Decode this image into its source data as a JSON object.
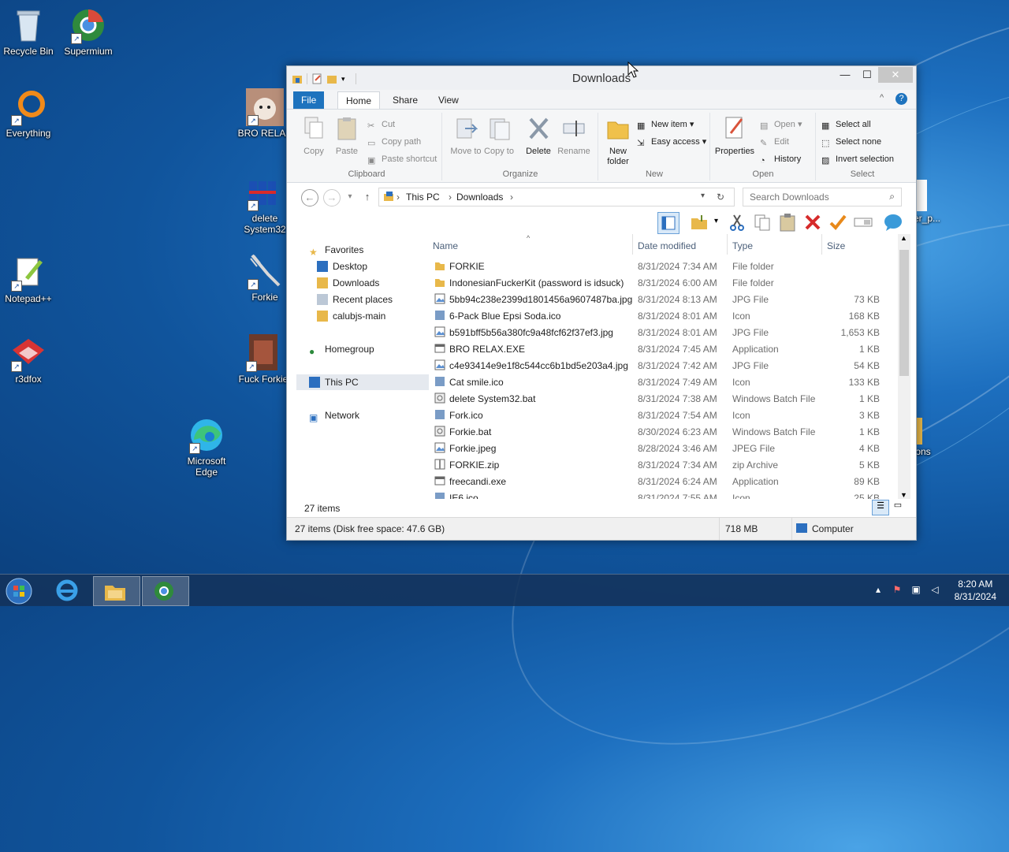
{
  "desktop": {
    "icons": [
      {
        "label": "Recycle Bin"
      },
      {
        "label": "Supermium"
      },
      {
        "label": "Everything"
      },
      {
        "label": "BRO RELAX"
      },
      {
        "label": "delete System32"
      },
      {
        "label": "Notepad++"
      },
      {
        "label": "Forkie"
      },
      {
        "label": "r3dfox"
      },
      {
        "label": "Fuck Forkie"
      },
      {
        "label": "Microsoft Edge"
      },
      {
        "label": "er_p..."
      },
      {
        "label": "ons"
      }
    ]
  },
  "window": {
    "title": "Downloads",
    "tabs": {
      "file": "File",
      "home": "Home",
      "share": "Share",
      "view": "View"
    },
    "ribbon": {
      "clipboard": {
        "label": "Clipboard",
        "copy": "Copy",
        "paste": "Paste",
        "cut": "Cut",
        "copy_path": "Copy path",
        "paste_shortcut": "Paste shortcut"
      },
      "organize": {
        "label": "Organize",
        "move_to": "Move to",
        "copy_to": "Copy to",
        "delete": "Delete",
        "rename": "Rename"
      },
      "new": {
        "label": "New",
        "new_folder": "New folder",
        "new_item": "New item",
        "easy_access": "Easy access"
      },
      "open": {
        "label": "Open",
        "properties": "Properties",
        "open": "Open",
        "edit": "Edit",
        "history": "History"
      },
      "select": {
        "label": "Select",
        "select_all": "Select all",
        "select_none": "Select none",
        "invert": "Invert selection"
      }
    },
    "address": {
      "crumb1": "This PC",
      "crumb2": "Downloads",
      "search_placeholder": "Search Downloads"
    },
    "nav": {
      "favorites": "Favorites",
      "desktop": "Desktop",
      "downloads": "Downloads",
      "recent": "Recent places",
      "calubjs": "calubjs-main",
      "homegroup": "Homegroup",
      "thispc": "This PC",
      "network": "Network"
    },
    "columns": {
      "name": "Name",
      "date": "Date modified",
      "type": "Type",
      "size": "Size"
    },
    "files": [
      {
        "name": "FORKIE",
        "date": "8/31/2024 7:34 AM",
        "type": "File folder",
        "size": ""
      },
      {
        "name": "IndonesianFuckerKit (password is idsuck)",
        "date": "8/31/2024 6:00 AM",
        "type": "File folder",
        "size": ""
      },
      {
        "name": "5bb94c238e2399d1801456a9607487ba.jpg",
        "date": "8/31/2024 8:13 AM",
        "type": "JPG File",
        "size": "73 KB"
      },
      {
        "name": "6-Pack Blue Epsi Soda.ico",
        "date": "8/31/2024 8:01 AM",
        "type": "Icon",
        "size": "168 KB"
      },
      {
        "name": "b591bff5b56a380fc9a48fcf62f37ef3.jpg",
        "date": "8/31/2024 8:01 AM",
        "type": "JPG File",
        "size": "1,653 KB"
      },
      {
        "name": "BRO RELAX.EXE",
        "date": "8/31/2024 7:45 AM",
        "type": "Application",
        "size": "1 KB"
      },
      {
        "name": "c4e93414e9e1f8c544cc6b1bd5e203a4.jpg",
        "date": "8/31/2024 7:42 AM",
        "type": "JPG File",
        "size": "54 KB"
      },
      {
        "name": "Cat smile.ico",
        "date": "8/31/2024 7:49 AM",
        "type": "Icon",
        "size": "133 KB"
      },
      {
        "name": "delete System32.bat",
        "date": "8/31/2024 7:38 AM",
        "type": "Windows Batch File",
        "size": "1 KB"
      },
      {
        "name": "Fork.ico",
        "date": "8/31/2024 7:54 AM",
        "type": "Icon",
        "size": "3 KB"
      },
      {
        "name": "Forkie.bat",
        "date": "8/30/2024 6:23 AM",
        "type": "Windows Batch File",
        "size": "1 KB"
      },
      {
        "name": "Forkie.jpeg",
        "date": "8/28/2024 3:46 AM",
        "type": "JPEG File",
        "size": "4 KB"
      },
      {
        "name": "FORKIE.zip",
        "date": "8/31/2024 7:34 AM",
        "type": "zip Archive",
        "size": "5 KB"
      },
      {
        "name": "freecandi.exe",
        "date": "8/31/2024 6:24 AM",
        "type": "Application",
        "size": "89 KB"
      },
      {
        "name": "IE6.ico",
        "date": "8/31/2024 7:55 AM",
        "type": "Icon",
        "size": "25 KB"
      }
    ],
    "items_count": "27 items",
    "status": {
      "left": "27 items (Disk free space: 47.6 GB)",
      "size": "718 MB",
      "location": "Computer"
    }
  },
  "taskbar": {
    "time": "8:20 AM",
    "date": "8/31/2024"
  },
  "colors": {
    "accent": "#1e73be",
    "file_tab": "#1e73be",
    "folder": "#e8b84a"
  }
}
